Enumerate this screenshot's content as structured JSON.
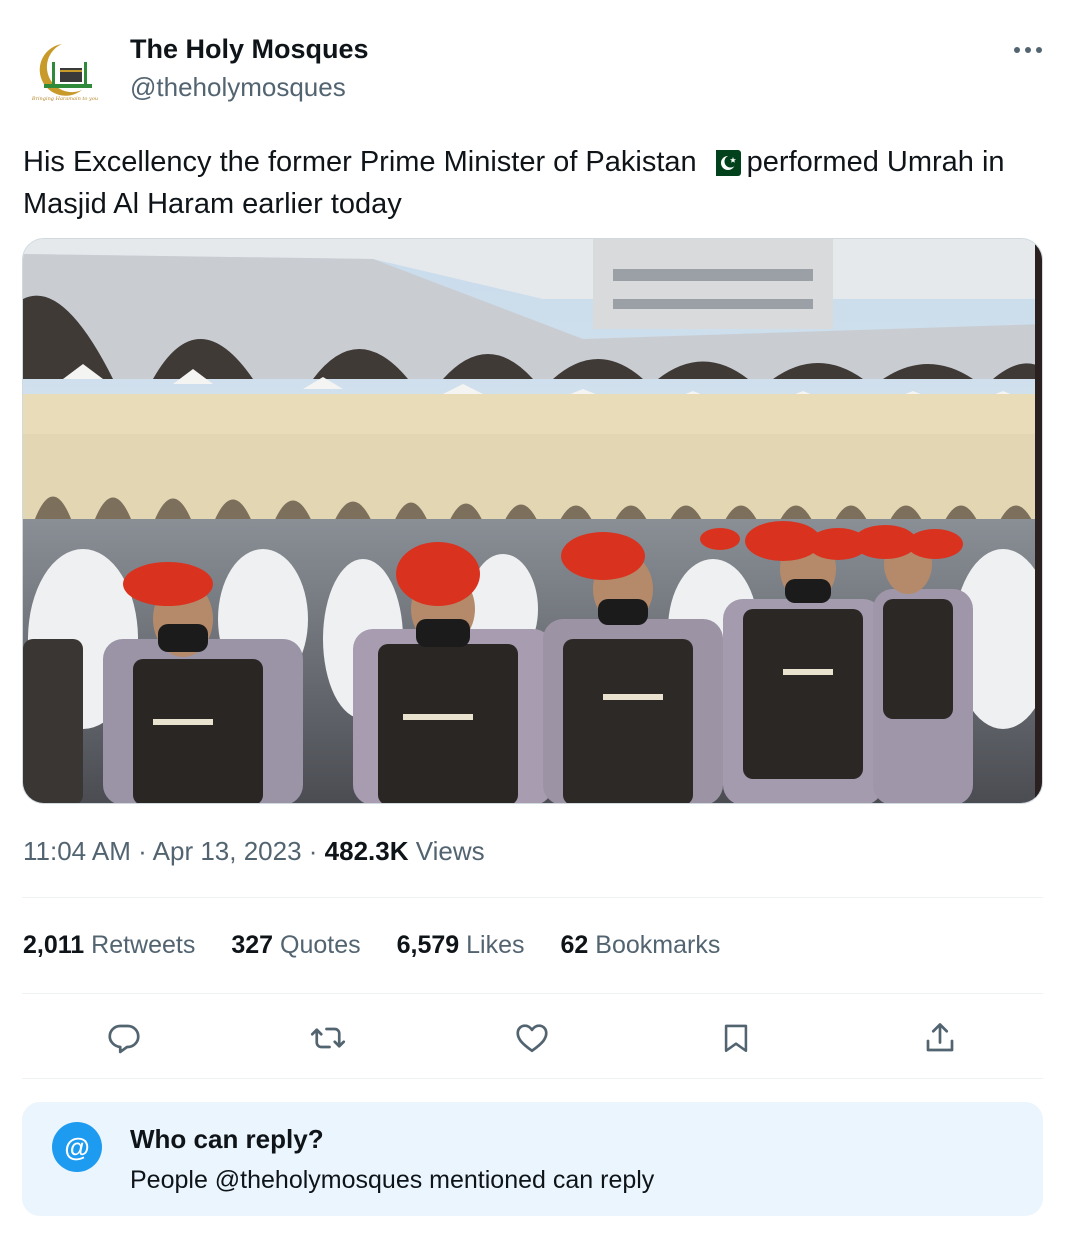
{
  "author": {
    "display_name": "The Holy Mosques",
    "handle": "@theholymosques",
    "avatar_tagline": "Bringing Haramain to you"
  },
  "tweet": {
    "text_before_flag": "His Excellency the former Prime Minister of Pakistan",
    "flag_icon": "pakistan-flag-icon",
    "text_after_flag": "performed Umrah in Masjid Al Haram earlier today"
  },
  "meta": {
    "time": "11:04 AM",
    "sep1": "·",
    "date": "Apr 13, 2023",
    "sep2": "·",
    "views_count": "482.3K",
    "views_label": "Views"
  },
  "stats": [
    {
      "count": "2,011",
      "label": "Retweets"
    },
    {
      "count": "327",
      "label": "Quotes"
    },
    {
      "count": "6,579",
      "label": "Likes"
    },
    {
      "count": "62",
      "label": "Bookmarks"
    }
  ],
  "actions": [
    "reply-icon",
    "retweet-icon",
    "like-icon",
    "bookmark-icon",
    "share-icon"
  ],
  "who_can_reply": {
    "icon": "@",
    "title": "Who can reply?",
    "subtitle": "People @theholymosques mentioned can reply"
  },
  "colors": {
    "text_primary": "#0f1419",
    "text_secondary": "#536471",
    "accent": "#1d9bf0",
    "reply_box_bg": "#eaf5fd",
    "beret_red": "#d9331f"
  }
}
